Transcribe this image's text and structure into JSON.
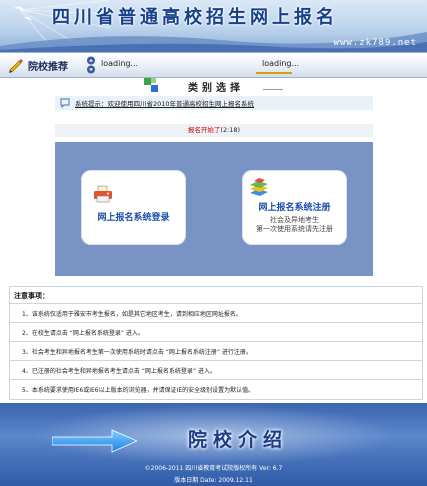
{
  "header": {
    "title": "四川省普通高校招生网上报名",
    "url": "www.zk789.net"
  },
  "nav": {
    "label": "院校推荐",
    "loading_left": "loading...",
    "loading_right": "loading..."
  },
  "category": {
    "title": "类别选择"
  },
  "notice": {
    "text": "系统提示：欢迎使用四川省2010年普通高校招生网上报名系统"
  },
  "status": {
    "open_label": "报名开始了",
    "time": "(2:18)"
  },
  "buttons": {
    "login": {
      "label": "网上报名系统登录"
    },
    "register": {
      "label": "网上报名系统注册",
      "sub_line1": "社会及异地考生",
      "sub_line2": "第一次使用系统请先注册"
    }
  },
  "notes": {
    "title": "注意事项：",
    "items": [
      "1、该系统仅适用于雅安市考生报名，如是其它地区考生，请到相应地区网址报名。",
      "2、在校生请点击 “网上报名系统登录” 进入。",
      "3、社会考生和异地报名考生第一次使用系统时请点击 “网上报名系统注册” 进行注册。",
      "4、已注册的社会考生和异地报名考生请点击 “网上报名系统登录” 进入。",
      "5、本系统要求使用IE6或IE6以上版本的浏览器，并请保证IE的安全级别设置为默认值。"
    ]
  },
  "footer": {
    "banner_title": "院校介绍",
    "copyright": "©2006-2011 四川省教育考试院版权所有 Ver: 6.7",
    "version_date": "版本日期 Date: 2009.12.11"
  },
  "colors": {
    "panel": "#7a93c5",
    "accent": "#1a4ea8",
    "status_red": "#d10000"
  }
}
